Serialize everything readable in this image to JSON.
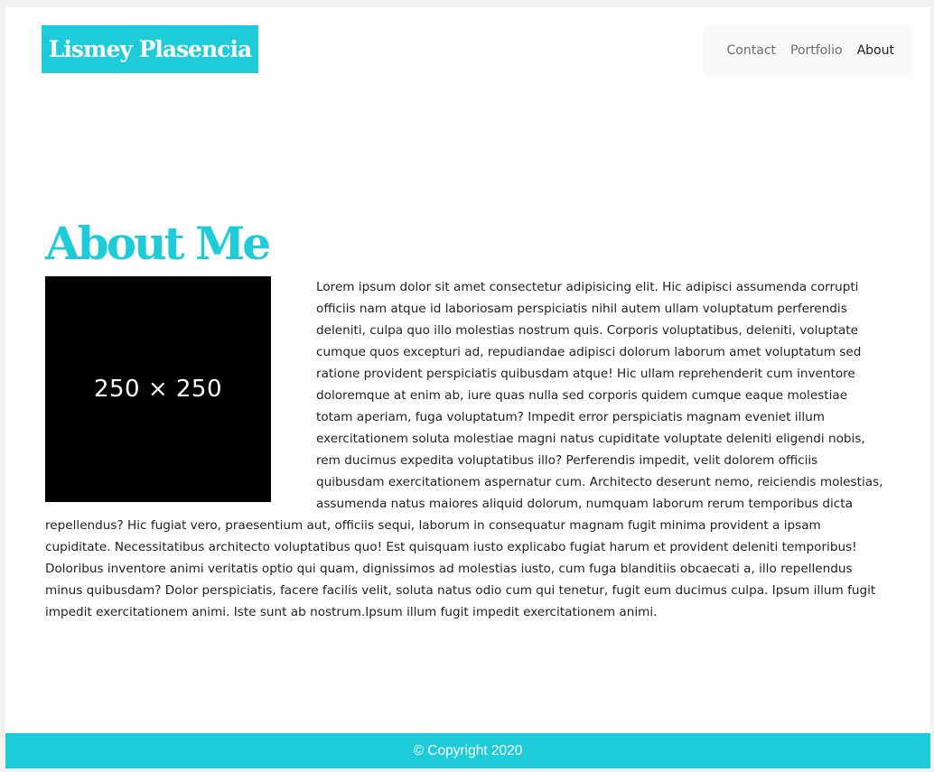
{
  "header": {
    "brand": "Lismey Plasencia",
    "nav": [
      {
        "label": "Contact",
        "active": false
      },
      {
        "label": "Portfolio",
        "active": false
      },
      {
        "label": "About",
        "active": true
      }
    ]
  },
  "main": {
    "title": "About Me",
    "image_placeholder": "250 × 250",
    "paragraph": "Lorem ipsum dolor sit amet consectetur adipisicing elit. Hic adipisci assumenda corrupti officiis nam atque id laboriosam perspiciatis nihil autem ullam voluptatum perferendis deleniti, culpa quo illo molestias nostrum quis. Corporis voluptatibus, deleniti, voluptate cumque quos excepturi ad, repudiandae adipisci dolorum laborum amet voluptatum sed ratione provident perspiciatis quibusdam atque! Hic ullam reprehenderit cum inventore doloremque at enim ab, iure quas nulla sed corporis quidem cumque eaque molestiae totam aperiam, fuga voluptatum? Impedit error perspiciatis magnam eveniet illum exercitationem soluta molestiae magni natus cupiditate voluptate deleniti eligendi nobis, rem ducimus expedita voluptatibus illo? Perferendis impedit, velit dolorem officiis quibusdam exercitationem aspernatur cum. Architecto deserunt nemo, reiciendis molestias, assumenda natus maiores aliquid dolorum, numquam laborum rerum temporibus dicta repellendus? Hic fugiat vero, praesentium aut, officiis sequi, laborum in consequatur magnam fugit minima provident a ipsam cupiditate. Necessitatibus architecto voluptatibus quo! Est quisquam iusto explicabo fugiat harum et provident deleniti temporibus! Doloribus inventore animi veritatis optio qui quam, dignissimos ad molestias iusto, cum fuga blanditiis obcaecati a, illo repellendus minus quibusdam? Dolor perspiciatis, facere facilis velit, soluta natus odio cum qui tenetur, fugit eum ducimus culpa. Ipsum illum fugit impedit exercitationem animi. Iste sunt ab nostrum.Ipsum illum fugit impedit exercitationem animi."
  },
  "footer": {
    "copyright": "© Copyright 2020"
  },
  "colors": {
    "accent": "#1ecbd9",
    "nav_background": "#f8f9fa",
    "text": "#222222",
    "nav_inactive": "#6f6f6f"
  }
}
